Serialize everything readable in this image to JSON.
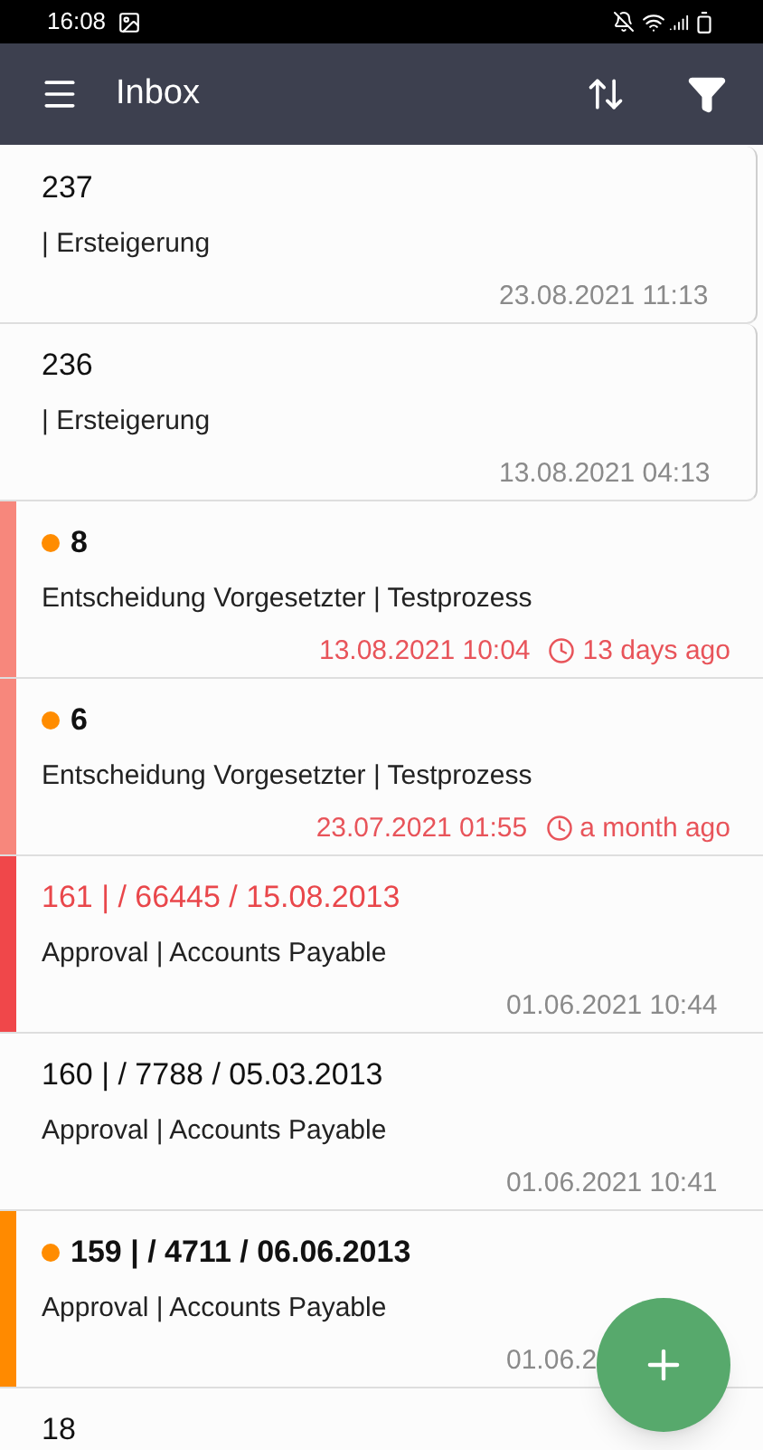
{
  "status_bar": {
    "time": "16:08"
  },
  "toolbar": {
    "title": "Inbox"
  },
  "items": [
    {
      "title": "237",
      "subtitle": "| Ersteigerung",
      "date": "23.08.2021 11:13",
      "unread": false,
      "outlined": true,
      "title_alert": false
    },
    {
      "title": "236",
      "subtitle": "| Ersteigerung",
      "date": "13.08.2021 04:13",
      "unread": false,
      "outlined": true,
      "title_alert": false
    },
    {
      "title": "8",
      "subtitle": "Entscheidung Vorgesetzter | Testprozess",
      "date": "13.08.2021 10:04",
      "age": "13 days ago",
      "unread": true,
      "outlined": false,
      "title_alert": false,
      "color": "#f7877c"
    },
    {
      "title": "6",
      "subtitle": "Entscheidung Vorgesetzter | Testprozess",
      "date": "23.07.2021 01:55",
      "age": "a month ago",
      "unread": true,
      "outlined": false,
      "title_alert": false,
      "color": "#f7877c"
    },
    {
      "title": "161 | / 66445 / 15.08.2013",
      "subtitle": "Approval | Accounts Payable",
      "date": "01.06.2021 10:44",
      "unread": false,
      "outlined": false,
      "title_alert": true,
      "color": "#f0474a"
    },
    {
      "title": "160 | / 7788 / 05.03.2013",
      "subtitle": "Approval | Accounts Payable",
      "date": "01.06.2021 10:41",
      "unread": false,
      "outlined": false,
      "title_alert": false
    },
    {
      "title": "159 | / 4711 / 06.06.2013",
      "subtitle": "Approval | Accounts Payable",
      "date": "01.06.2",
      "unread": true,
      "outlined": false,
      "title_alert": false,
      "color": "#ff8a00"
    },
    {
      "title": "18",
      "unread": false,
      "outlined": false,
      "title_alert": false
    }
  ]
}
